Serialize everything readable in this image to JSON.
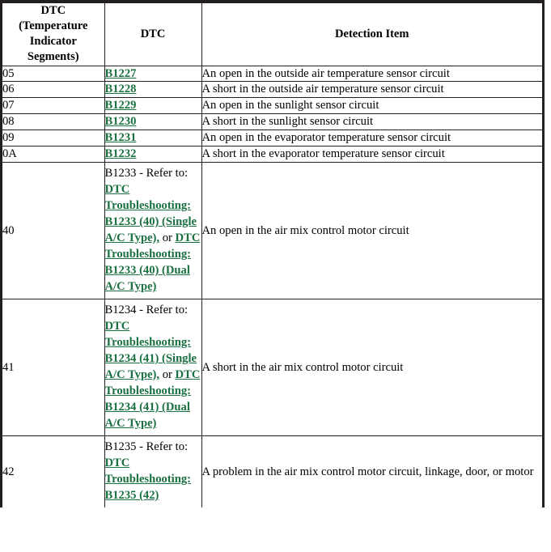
{
  "table": {
    "headers": [
      {
        "id": "segments",
        "lines": [
          "DTC",
          "(Temperature",
          "Indicator",
          "Segments)"
        ]
      },
      {
        "id": "dtc",
        "lines": [
          "DTC"
        ]
      },
      {
        "id": "detection_item",
        "lines": [
          "Detection Item"
        ]
      }
    ],
    "rows": [
      {
        "segment": "05",
        "dtc_prefix": "",
        "dtc_links": [
          "B1227"
        ],
        "dtc_conjunction": "",
        "detection_item": "An open in the outside air temperature sensor circuit"
      },
      {
        "segment": "06",
        "dtc_prefix": "",
        "dtc_links": [
          "B1228"
        ],
        "dtc_conjunction": "",
        "detection_item": "A short in the outside air temperature sensor circuit"
      },
      {
        "segment": "07",
        "dtc_prefix": "",
        "dtc_links": [
          "B1229"
        ],
        "dtc_conjunction": "",
        "detection_item": "An open in the sunlight sensor circuit"
      },
      {
        "segment": "08",
        "dtc_prefix": "",
        "dtc_links": [
          "B1230"
        ],
        "dtc_conjunction": "",
        "detection_item": "A short in the sunlight sensor circuit"
      },
      {
        "segment": "09",
        "dtc_prefix": "",
        "dtc_links": [
          "B1231"
        ],
        "dtc_conjunction": "",
        "detection_item": "An open in the evaporator temperature sensor circuit"
      },
      {
        "segment": "0A",
        "dtc_prefix": "",
        "dtc_links": [
          "B1232"
        ],
        "dtc_conjunction": "",
        "detection_item": "A short in the evaporator temperature sensor circuit"
      },
      {
        "segment": "40",
        "dtc_prefix": "B1233 - Refer to: ",
        "dtc_links": [
          "DTC Troubleshooting: B1233 (40) (Single A/C Type),",
          "DTC Troubleshooting: B1233 (40) (Dual A/C Type)"
        ],
        "dtc_conjunction": " or ",
        "detection_item": "An open in the air mix control motor circuit"
      },
      {
        "segment": "41",
        "dtc_prefix": "B1234 - Refer to: ",
        "dtc_links": [
          "DTC Troubleshooting: B1234 (41) (Single A/C Type),",
          "DTC Troubleshooting: B1234 (41) (Dual A/C Type)"
        ],
        "dtc_conjunction": " or ",
        "detection_item": "A short in the air mix control motor circuit"
      },
      {
        "segment": "42",
        "dtc_prefix": "B1235 - Refer to: ",
        "dtc_links": [
          "DTC Troubleshooting: B1235 (42)"
        ],
        "dtc_conjunction": "",
        "detection_item": "A problem in the air mix control motor circuit, linkage, door, or motor"
      }
    ]
  },
  "colors": {
    "link": "#1a7040",
    "border": "#231f20",
    "text": "#000000",
    "background": "#ffffff"
  }
}
